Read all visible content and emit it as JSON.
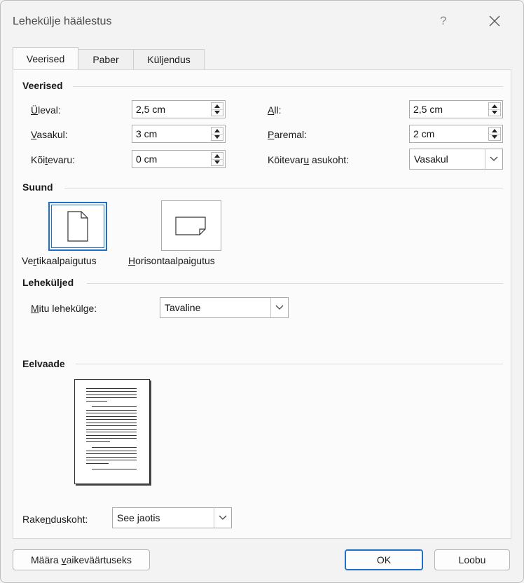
{
  "window": {
    "title": "Lehekülje häälestus",
    "help": "?"
  },
  "tabs": [
    "Veerised",
    "Paber",
    "Küljendus"
  ],
  "margins": {
    "group": "Veerised",
    "top": {
      "label": "Üleval:",
      "value": "2,5 cm"
    },
    "bottom": {
      "label": "All:",
      "value": "2,5 cm"
    },
    "left": {
      "label": "Vasakul:",
      "value": "3 cm"
    },
    "right": {
      "label": "Paremal:",
      "value": "2 cm"
    },
    "gutter": {
      "label": "Köitevaru:",
      "value": "0 cm"
    },
    "gutter_pos": {
      "label": "Köitevaru asukoht:",
      "value": "Vasakul"
    }
  },
  "orientation": {
    "group": "Suund",
    "portrait": "Vertikaalpaigutus",
    "landscape": "Horisontaalpaigutus",
    "selected": "portrait"
  },
  "pages": {
    "group": "Leheküljed",
    "multiple_label": "Mitu lehekülge:",
    "multiple_value": "Tavaline"
  },
  "preview": {
    "group": "Eelvaade"
  },
  "apply": {
    "label": "Rakenduskoht:",
    "value": "See jaotis"
  },
  "buttons": {
    "default": "Määra vaikeväärtuseks",
    "ok": "OK",
    "cancel": "Loobu"
  },
  "colors": {
    "accent": "#1e6fc8",
    "background": "#f3f3f3"
  }
}
